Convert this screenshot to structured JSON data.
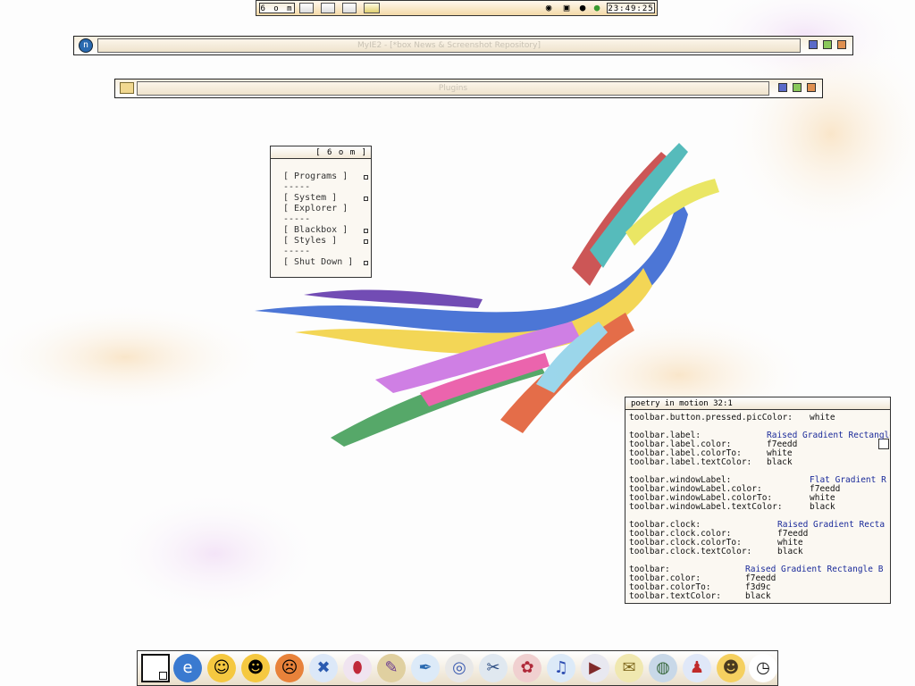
{
  "toolbar": {
    "label": "6 o m",
    "clock": "23:49:25",
    "icons": [
      "terminal-icon",
      "browser-icon",
      "gear-icon",
      "editor-icon",
      "monitor-icon",
      "speaker-icon",
      "network-icon",
      "user-icon",
      "users-icon"
    ]
  },
  "windows": [
    {
      "title": "MyIE2 - [*box News & Screenshot Repository]",
      "icon": "myie-icon"
    },
    {
      "title": "Plugins",
      "icon": "folder-icon"
    }
  ],
  "menu": {
    "title": "[ 6 o m ]",
    "items": [
      "[ Programs ]",
      "-----",
      "[ System ]",
      "[ Explorer ]",
      "-----",
      "[ Blackbox ]",
      "[ Styles ]",
      "-----",
      "[ Shut Down ]"
    ]
  },
  "viewer": {
    "title": "poetry in motion  32:1",
    "lines": [
      {
        "key": "toolbar.button.pressed.picColor:",
        "val": "white",
        "blue": false
      },
      {
        "key": "toolbar.label:",
        "val": "Raised Gradient Rectangle",
        "blue": true
      },
      {
        "key": "toolbar.label.color:",
        "val": "f7eedd",
        "blue": false
      },
      {
        "key": "toolbar.label.colorTo:",
        "val": "white",
        "blue": false
      },
      {
        "key": "toolbar.label.textColor:",
        "val": "black",
        "blue": false
      },
      {
        "key": "toolbar.windowLabel:",
        "val": "Flat Gradient R",
        "blue": true
      },
      {
        "key": "toolbar.windowLabel.color:",
        "val": "f7eedd",
        "blue": false
      },
      {
        "key": "toolbar.windowLabel.colorTo:",
        "val": "white",
        "blue": false
      },
      {
        "key": "toolbar.windowLabel.textColor:",
        "val": "black",
        "blue": false
      },
      {
        "key": "toolbar.clock:",
        "val": "Raised Gradient Recta",
        "blue": true
      },
      {
        "key": "toolbar.clock.color:",
        "val": "f7eedd",
        "blue": false
      },
      {
        "key": "toolbar.clock.colorTo:",
        "val": "white",
        "blue": false
      },
      {
        "key": "toolbar.clock.textColor:",
        "val": "black",
        "blue": false
      },
      {
        "key": "toolbar:",
        "val": "Raised Gradient Rectangle B",
        "blue": true
      },
      {
        "key": "toolbar.color:",
        "val": "f7eedd",
        "blue": false
      },
      {
        "key": "toolbar.colorTo:",
        "val": "f3d9c",
        "blue": false
      },
      {
        "key": "toolbar.textColor:",
        "val": "black",
        "blue": false
      }
    ]
  },
  "dock": {
    "icons": [
      "desktop-icon",
      "ie-icon",
      "smiley-icon",
      "grin-icon",
      "angry-icon",
      "x-icon",
      "pill-icon",
      "paint-icon",
      "pen-icon",
      "cd-icon",
      "tool-icon",
      "flower-icon",
      "music-icon",
      "media-icon",
      "scroll-icon",
      "globe-icon",
      "joystick-icon",
      "character-icon",
      "clock-icon"
    ]
  },
  "colors": {
    "accent": "#f3d9a8",
    "label": "#f7eedd",
    "border": "#333333"
  }
}
